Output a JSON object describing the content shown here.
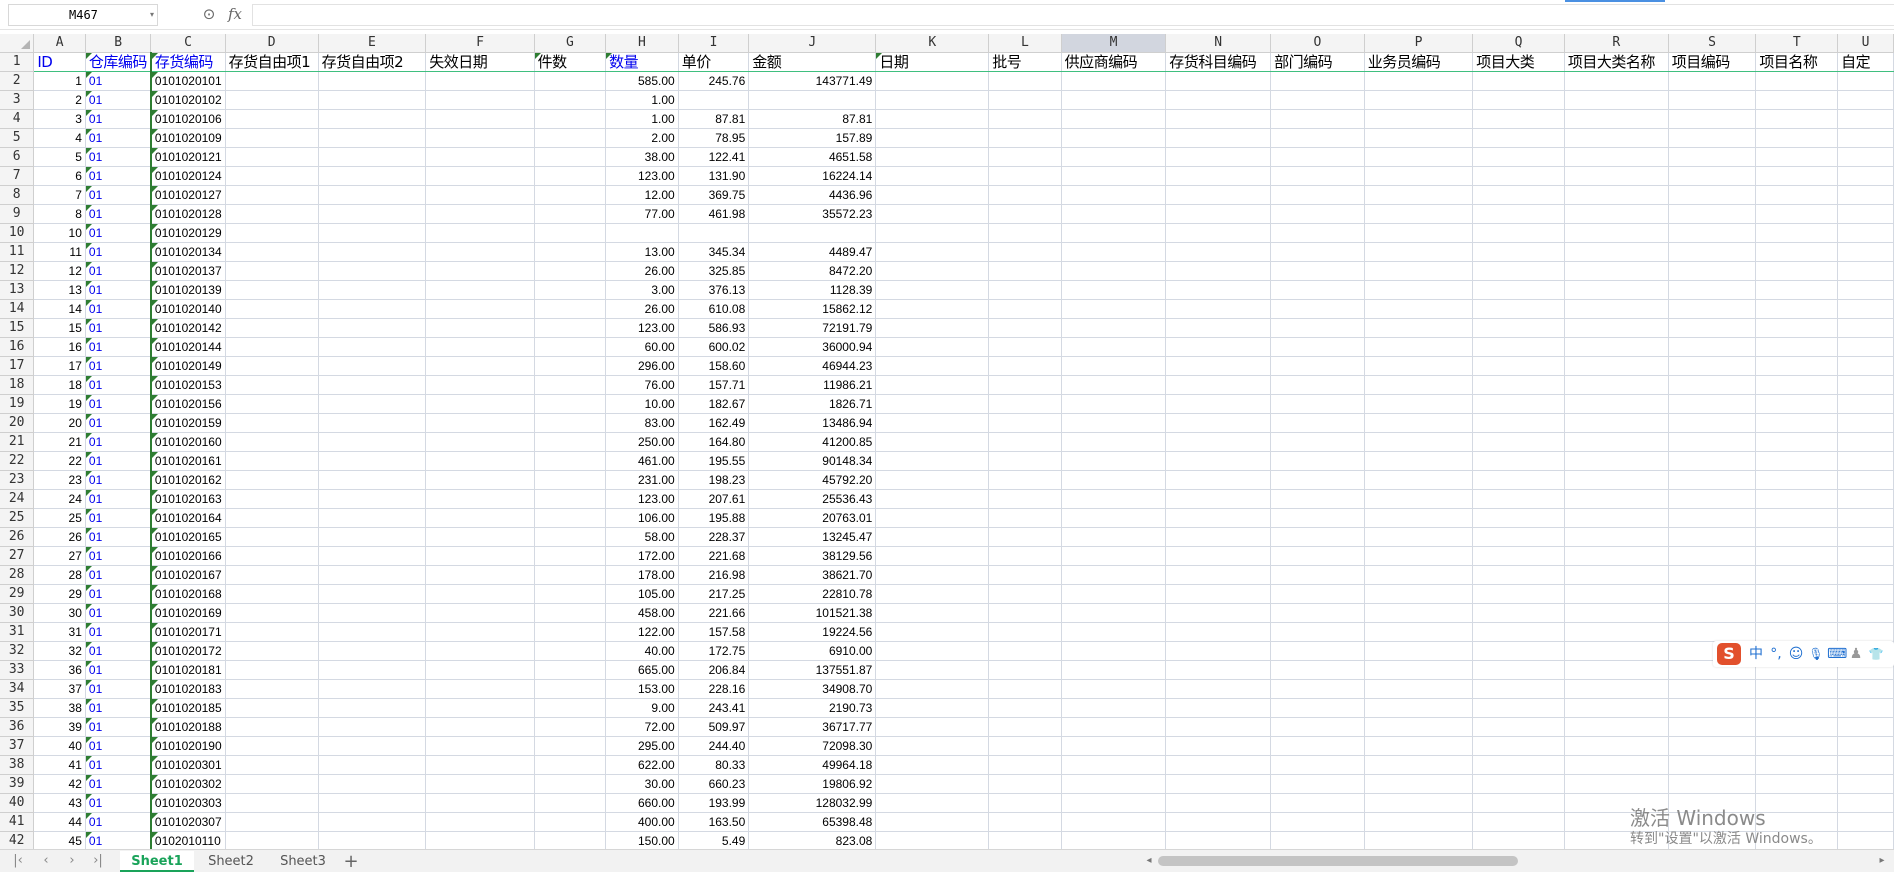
{
  "formula_bar": {
    "name_box": "M467",
    "name_box_dropdown_icon": "caret-down-icon",
    "zoom_icon": "magnifier-icon",
    "fx_label": "fx",
    "formula_value": ""
  },
  "grid": {
    "selected_column": "M",
    "columns": [
      "A",
      "B",
      "C",
      "D",
      "E",
      "F",
      "G",
      "H",
      "I",
      "J",
      "K",
      "L",
      "M",
      "N",
      "O",
      "P",
      "Q",
      "R",
      "S",
      "T",
      "U"
    ],
    "header_row": {
      "row_num": "1",
      "cells": [
        "ID",
        "仓库编码",
        "存货编码",
        "存货自由项1",
        "存货自由项2",
        "失效日期",
        "件数",
        "数量",
        "单价",
        "金额",
        "日期",
        "批号",
        "供应商编码",
        "存货科目编码",
        "部门编码",
        "业务员编码",
        "项目大类",
        "项目大类名称",
        "项目编码",
        "项目名称",
        "自定"
      ]
    },
    "rows": [
      {
        "r": "2",
        "id": "1",
        "wh": "01",
        "code": "0101020101",
        "qty": "585.00",
        "price": "245.76",
        "amount": "143771.49"
      },
      {
        "r": "3",
        "id": "2",
        "wh": "01",
        "code": "0101020102",
        "qty": "1.00",
        "price": "",
        "amount": ""
      },
      {
        "r": "4",
        "id": "3",
        "wh": "01",
        "code": "0101020106",
        "qty": "1.00",
        "price": "87.81",
        "amount": "87.81"
      },
      {
        "r": "5",
        "id": "4",
        "wh": "01",
        "code": "0101020109",
        "qty": "2.00",
        "price": "78.95",
        "amount": "157.89"
      },
      {
        "r": "6",
        "id": "5",
        "wh": "01",
        "code": "0101020121",
        "qty": "38.00",
        "price": "122.41",
        "amount": "4651.58"
      },
      {
        "r": "7",
        "id": "6",
        "wh": "01",
        "code": "0101020124",
        "qty": "123.00",
        "price": "131.90",
        "amount": "16224.14"
      },
      {
        "r": "8",
        "id": "7",
        "wh": "01",
        "code": "0101020127",
        "qty": "12.00",
        "price": "369.75",
        "amount": "4436.96"
      },
      {
        "r": "9",
        "id": "8",
        "wh": "01",
        "code": "0101020128",
        "qty": "77.00",
        "price": "461.98",
        "amount": "35572.23"
      },
      {
        "r": "10",
        "id": "10",
        "wh": "01",
        "code": "0101020129",
        "qty": "",
        "price": "",
        "amount": ""
      },
      {
        "r": "11",
        "id": "11",
        "wh": "01",
        "code": "0101020134",
        "qty": "13.00",
        "price": "345.34",
        "amount": "4489.47"
      },
      {
        "r": "12",
        "id": "12",
        "wh": "01",
        "code": "0101020137",
        "qty": "26.00",
        "price": "325.85",
        "amount": "8472.20"
      },
      {
        "r": "13",
        "id": "13",
        "wh": "01",
        "code": "0101020139",
        "qty": "3.00",
        "price": "376.13",
        "amount": "1128.39"
      },
      {
        "r": "14",
        "id": "14",
        "wh": "01",
        "code": "0101020140",
        "qty": "26.00",
        "price": "610.08",
        "amount": "15862.12"
      },
      {
        "r": "15",
        "id": "15",
        "wh": "01",
        "code": "0101020142",
        "qty": "123.00",
        "price": "586.93",
        "amount": "72191.79"
      },
      {
        "r": "16",
        "id": "16",
        "wh": "01",
        "code": "0101020144",
        "qty": "60.00",
        "price": "600.02",
        "amount": "36000.94"
      },
      {
        "r": "17",
        "id": "17",
        "wh": "01",
        "code": "0101020149",
        "qty": "296.00",
        "price": "158.60",
        "amount": "46944.23"
      },
      {
        "r": "18",
        "id": "18",
        "wh": "01",
        "code": "0101020153",
        "qty": "76.00",
        "price": "157.71",
        "amount": "11986.21"
      },
      {
        "r": "19",
        "id": "19",
        "wh": "01",
        "code": "0101020156",
        "qty": "10.00",
        "price": "182.67",
        "amount": "1826.71"
      },
      {
        "r": "20",
        "id": "20",
        "wh": "01",
        "code": "0101020159",
        "qty": "83.00",
        "price": "162.49",
        "amount": "13486.94"
      },
      {
        "r": "21",
        "id": "21",
        "wh": "01",
        "code": "0101020160",
        "qty": "250.00",
        "price": "164.80",
        "amount": "41200.85"
      },
      {
        "r": "22",
        "id": "22",
        "wh": "01",
        "code": "0101020161",
        "qty": "461.00",
        "price": "195.55",
        "amount": "90148.34"
      },
      {
        "r": "23",
        "id": "23",
        "wh": "01",
        "code": "0101020162",
        "qty": "231.00",
        "price": "198.23",
        "amount": "45792.20"
      },
      {
        "r": "24",
        "id": "24",
        "wh": "01",
        "code": "0101020163",
        "qty": "123.00",
        "price": "207.61",
        "amount": "25536.43"
      },
      {
        "r": "25",
        "id": "25",
        "wh": "01",
        "code": "0101020164",
        "qty": "106.00",
        "price": "195.88",
        "amount": "20763.01"
      },
      {
        "r": "26",
        "id": "26",
        "wh": "01",
        "code": "0101020165",
        "qty": "58.00",
        "price": "228.37",
        "amount": "13245.47"
      },
      {
        "r": "27",
        "id": "27",
        "wh": "01",
        "code": "0101020166",
        "qty": "172.00",
        "price": "221.68",
        "amount": "38129.56"
      },
      {
        "r": "28",
        "id": "28",
        "wh": "01",
        "code": "0101020167",
        "qty": "178.00",
        "price": "216.98",
        "amount": "38621.70"
      },
      {
        "r": "29",
        "id": "29",
        "wh": "01",
        "code": "0101020168",
        "qty": "105.00",
        "price": "217.25",
        "amount": "22810.78"
      },
      {
        "r": "30",
        "id": "30",
        "wh": "01",
        "code": "0101020169",
        "qty": "458.00",
        "price": "221.66",
        "amount": "101521.38"
      },
      {
        "r": "31",
        "id": "31",
        "wh": "01",
        "code": "0101020171",
        "qty": "122.00",
        "price": "157.58",
        "amount": "19224.56"
      },
      {
        "r": "32",
        "id": "32",
        "wh": "01",
        "code": "0101020172",
        "qty": "40.00",
        "price": "172.75",
        "amount": "6910.00"
      },
      {
        "r": "33",
        "id": "36",
        "wh": "01",
        "code": "0101020181",
        "qty": "665.00",
        "price": "206.84",
        "amount": "137551.87"
      },
      {
        "r": "34",
        "id": "37",
        "wh": "01",
        "code": "0101020183",
        "qty": "153.00",
        "price": "228.16",
        "amount": "34908.70"
      },
      {
        "r": "35",
        "id": "38",
        "wh": "01",
        "code": "0101020185",
        "qty": "9.00",
        "price": "243.41",
        "amount": "2190.73"
      },
      {
        "r": "36",
        "id": "39",
        "wh": "01",
        "code": "0101020188",
        "qty": "72.00",
        "price": "509.97",
        "amount": "36717.77"
      },
      {
        "r": "37",
        "id": "40",
        "wh": "01",
        "code": "0101020190",
        "qty": "295.00",
        "price": "244.40",
        "amount": "72098.30"
      },
      {
        "r": "38",
        "id": "41",
        "wh": "01",
        "code": "0101020301",
        "qty": "622.00",
        "price": "80.33",
        "amount": "49964.18"
      },
      {
        "r": "39",
        "id": "42",
        "wh": "01",
        "code": "0101020302",
        "qty": "30.00",
        "price": "660.23",
        "amount": "19806.92"
      },
      {
        "r": "40",
        "id": "43",
        "wh": "01",
        "code": "0101020303",
        "qty": "660.00",
        "price": "193.99",
        "amount": "128032.99"
      },
      {
        "r": "41",
        "id": "44",
        "wh": "01",
        "code": "0101020307",
        "qty": "400.00",
        "price": "163.50",
        "amount": "65398.48"
      },
      {
        "r": "42",
        "id": "45",
        "wh": "01",
        "code": "0102010110",
        "qty": "150.00",
        "price": "5.49",
        "amount": "823.08"
      }
    ]
  },
  "ime_toolbar": {
    "logo": "S",
    "items": [
      {
        "label": "中",
        "icon": "chinese-mode-icon"
      },
      {
        "label": "°,",
        "icon": "punctuation-icon"
      },
      {
        "label": "☺",
        "icon": "emoji-icon"
      },
      {
        "label": "🎙",
        "icon": "microphone-icon"
      },
      {
        "label": "⌨",
        "icon": "keyboard-icon"
      },
      {
        "label": "♟",
        "icon": "user-icon"
      },
      {
        "label": "👕",
        "icon": "skin-icon"
      }
    ]
  },
  "watermark": {
    "title": "激活 Windows",
    "subtitle": "转到\"设置\"以激活 Windows。"
  },
  "sheet_tabs": {
    "tabs": [
      "Sheet1",
      "Sheet2",
      "Sheet3"
    ],
    "active": "Sheet1",
    "add_label": "+",
    "nav": [
      "|<",
      "<",
      ">",
      ">|"
    ]
  }
}
